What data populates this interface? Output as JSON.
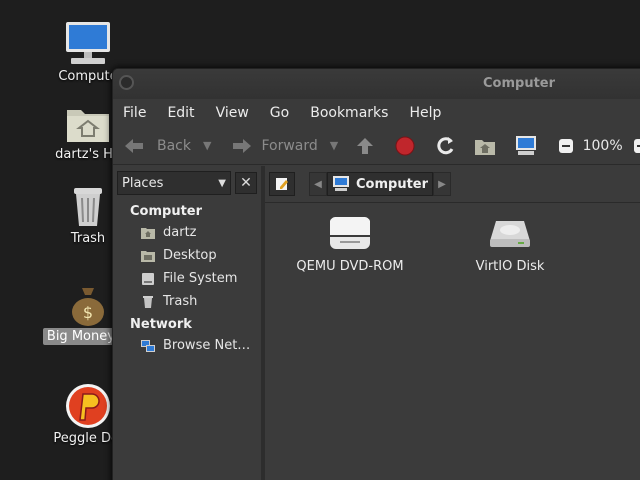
{
  "desktop": {
    "icons": [
      {
        "label": "Compute"
      },
      {
        "label": "dartz's Ho"
      },
      {
        "label": "Trash"
      },
      {
        "label": "Big Money D"
      },
      {
        "label": "Peggle Del"
      }
    ]
  },
  "window": {
    "title": "Computer",
    "menu": [
      "File",
      "Edit",
      "View",
      "Go",
      "Bookmarks",
      "Help"
    ],
    "toolbar": {
      "back": "Back",
      "forward": "Forward",
      "zoom": "100%"
    },
    "sidebar": {
      "selector": "Places",
      "close": "✕",
      "sections": [
        {
          "title": "Computer",
          "items": [
            "dartz",
            "Desktop",
            "File System",
            "Trash"
          ]
        },
        {
          "title": "Network",
          "items": [
            "Browse Net…"
          ]
        }
      ]
    },
    "path": {
      "current": "Computer"
    },
    "drives": [
      {
        "label": "QEMU DVD-ROM"
      },
      {
        "label": "VirtIO Disk"
      }
    ]
  },
  "colors": {
    "desktop_bg": "#1e1e1e",
    "window_bg": "#3b3b3b",
    "stop_red": "#c0262c"
  }
}
